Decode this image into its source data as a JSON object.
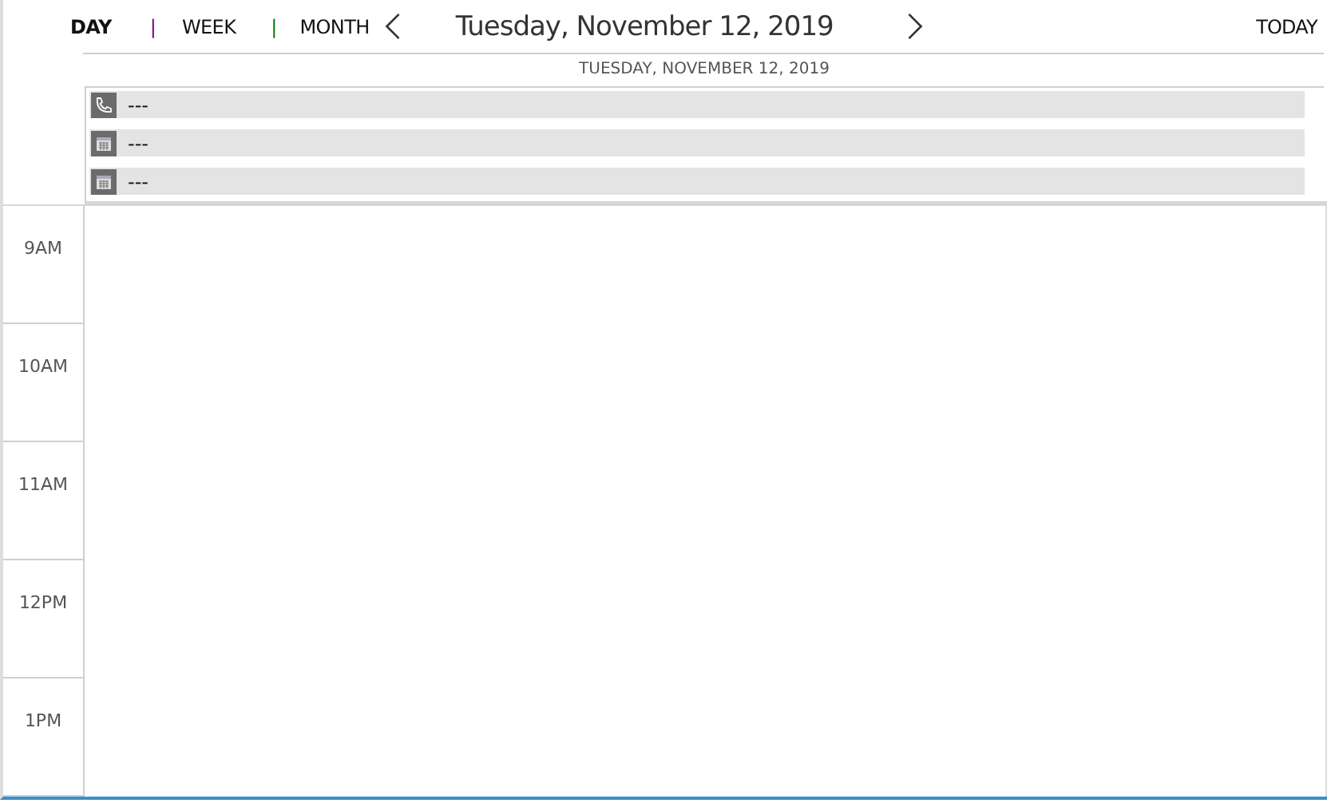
{
  "toolbar": {
    "views": [
      {
        "kind": "view",
        "label": "DAY",
        "selected": true
      },
      {
        "kind": "separator",
        "label": "|",
        "color": "#800080"
      },
      {
        "kind": "view",
        "label": "WEEK",
        "selected": false
      },
      {
        "kind": "separator",
        "label": "|",
        "color": "#008000"
      },
      {
        "kind": "view",
        "label": "MONTH",
        "selected": false
      }
    ],
    "title": "Tuesday, November 12, 2019",
    "today": "TODAY"
  },
  "day_header": "TUESDAY, NOVEMBER 12, 2019",
  "all_day_events": [
    {
      "kind": "phone",
      "label": "---"
    },
    {
      "kind": "calendar",
      "label": "---"
    },
    {
      "kind": "calendar",
      "label": "---"
    }
  ],
  "hours": [
    "9AM",
    "10AM",
    "11AM",
    "12PM",
    "1PM"
  ]
}
